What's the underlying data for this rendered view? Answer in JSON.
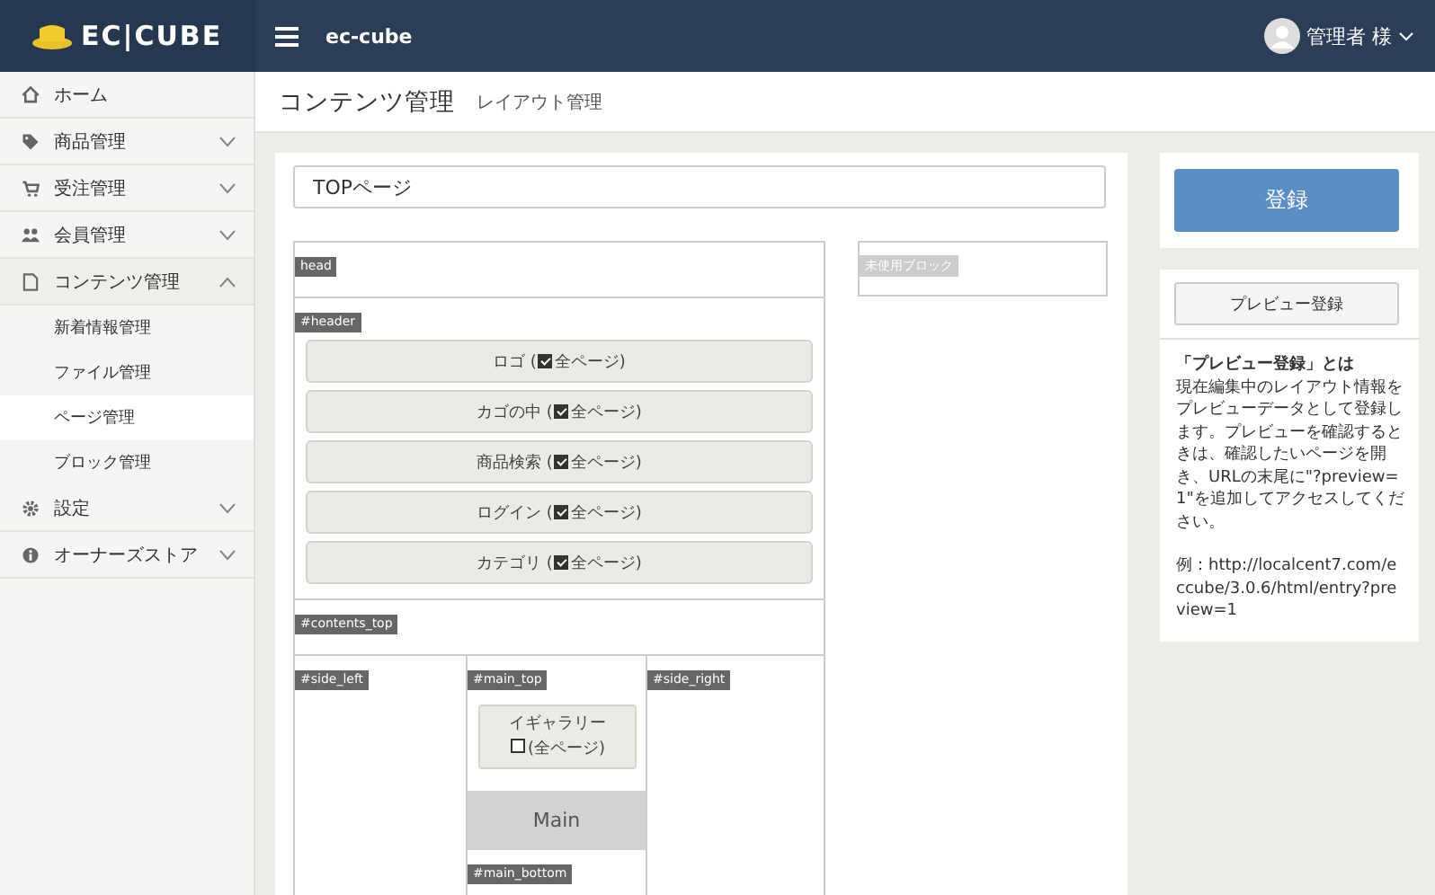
{
  "header": {
    "logo": "EC|CUBE",
    "site_name": "ec-cube",
    "user": "管理者 様"
  },
  "sidebar": {
    "items": [
      {
        "label": "ホーム",
        "kind": "link"
      },
      {
        "label": "商品管理",
        "kind": "group",
        "expanded": false
      },
      {
        "label": "受注管理",
        "kind": "group",
        "expanded": false
      },
      {
        "label": "会員管理",
        "kind": "group",
        "expanded": false
      },
      {
        "label": "コンテンツ管理",
        "kind": "group",
        "expanded": true,
        "children": [
          {
            "label": "新着情報管理",
            "selected": false
          },
          {
            "label": "ファイル管理",
            "selected": false
          },
          {
            "label": "ページ管理",
            "selected": true
          },
          {
            "label": "ブロック管理",
            "selected": false
          }
        ]
      },
      {
        "label": "設定",
        "kind": "group",
        "expanded": false
      },
      {
        "label": "オーナーズストア",
        "kind": "group",
        "expanded": false
      }
    ]
  },
  "page_title": {
    "title": "コンテンツ管理",
    "subtitle": "レイアウト管理"
  },
  "page_name_field": {
    "value": "TOPページ"
  },
  "layout": {
    "head": {
      "label": "head"
    },
    "header": {
      "label": "#header",
      "blocks": [
        {
          "name": "ロゴ (",
          "all_pages": true,
          "all_pages_label": "全ページ)"
        },
        {
          "name": "カゴの中 (",
          "all_pages": true,
          "all_pages_label": "全ページ)"
        },
        {
          "name": "商品検索 (",
          "all_pages": true,
          "all_pages_label": "全ページ)"
        },
        {
          "name": "ログイン (",
          "all_pages": true,
          "all_pages_label": "全ページ)"
        },
        {
          "name": "カテゴリ (",
          "all_pages": true,
          "all_pages_label": "全ページ)"
        }
      ]
    },
    "contents_top": {
      "label": "#contents_top"
    },
    "side_left": {
      "label": "#side_left"
    },
    "main_top": {
      "label": "#main_top",
      "blocks": [
        {
          "name": "イギャラリー",
          "all_pages": false,
          "all_pages_label": "(全ページ)"
        }
      ]
    },
    "main": {
      "label": "Main"
    },
    "main_bottom": {
      "label": "#main_bottom"
    },
    "side_right": {
      "label": "#side_right"
    },
    "unused": {
      "label": "未使用ブロック"
    }
  },
  "actions": {
    "register_button": "登録",
    "preview_button": "プレビュー登録"
  },
  "help": {
    "heading": "「プレビュー登録」とは",
    "body": "現在編集中のレイアウト情報をプレビューデータとして登録します。プレビューを確認するときは、確認したいページを開き、URLの末尾に\"?preview=1\"を追加してアクセスしてください。",
    "example": "例：http://localcent7.com/eccube/3.0.6/html/entry?preview=1"
  }
}
